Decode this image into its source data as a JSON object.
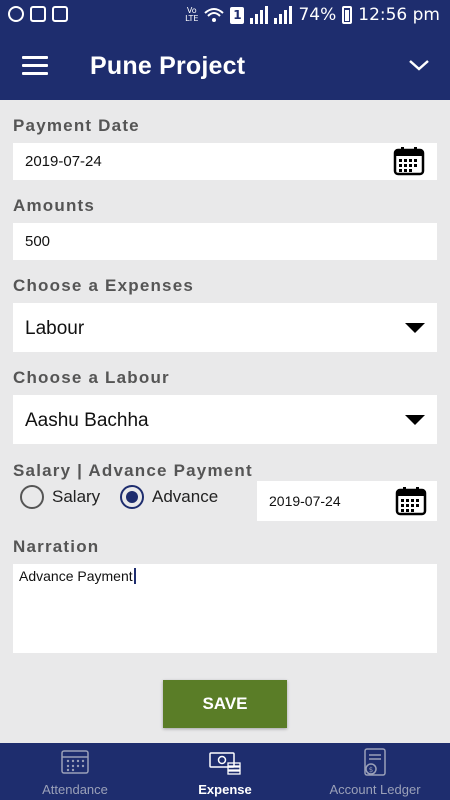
{
  "status": {
    "battery": "74%",
    "time": "12:56 pm",
    "volte": "Vo LTE",
    "sim": "1"
  },
  "appbar": {
    "title": "Pune Project"
  },
  "form": {
    "payment_date_label": "Payment Date",
    "payment_date_value": "2019-07-24",
    "amount_label": "Amounts",
    "amount_value": "500",
    "expense_label": "Choose a Expenses",
    "expense_value": "Labour",
    "labour_label": "Choose a Labour",
    "labour_value": "Aashu Bachha",
    "salary_label": "Salary | Advance Payment",
    "salary_option": "Salary",
    "advance_option": "Advance",
    "advance_selected": true,
    "advance_date": "2019-07-24",
    "narration_label": "Narration",
    "narration_value": "Advance Payment",
    "save_label": "SAVE"
  },
  "nav": {
    "items": [
      {
        "label": "Attendance",
        "icon": "calendar-grid-icon",
        "active": false
      },
      {
        "label": "Expense",
        "icon": "cash-icon",
        "active": true
      },
      {
        "label": "Account Ledger",
        "icon": "ledger-icon",
        "active": false
      }
    ]
  },
  "colors": {
    "primary": "#1e2d6e",
    "save": "#5a7d27",
    "background": "#e9e9ea"
  }
}
